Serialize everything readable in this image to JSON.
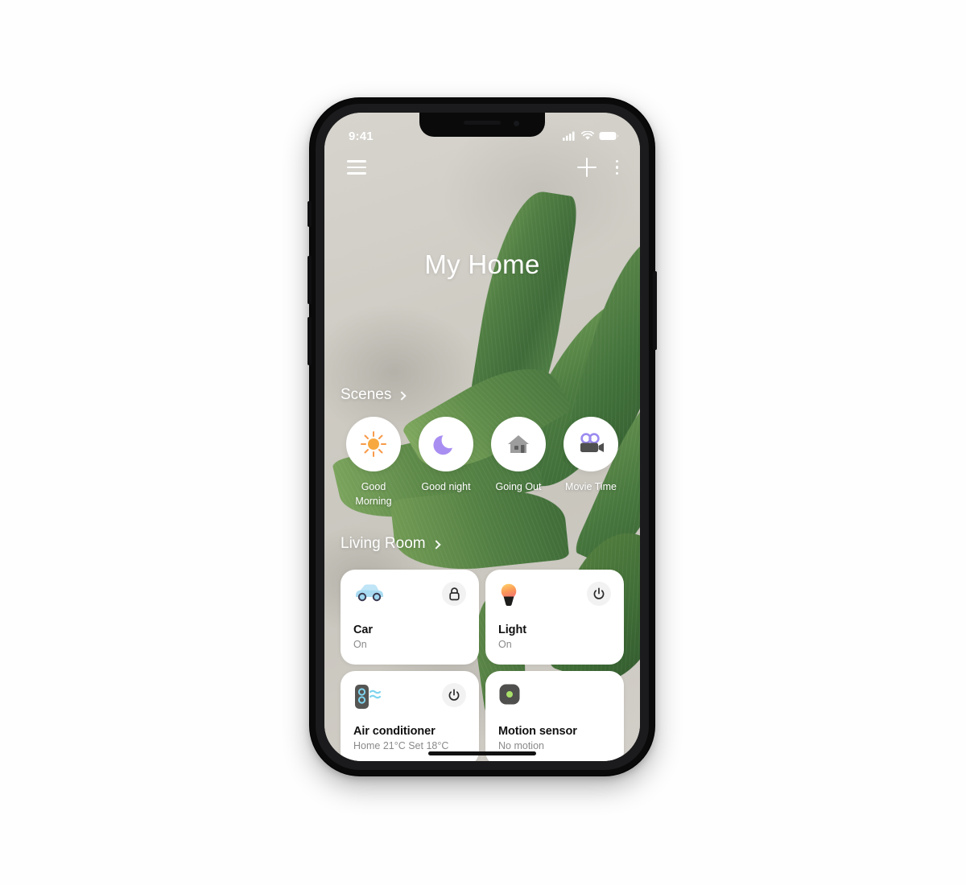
{
  "status_bar": {
    "time": "9:41",
    "icons": [
      "signal-icon",
      "wifi-icon",
      "battery-icon"
    ]
  },
  "top_bar": {
    "menu_icon": "hamburger-menu-icon",
    "add_icon": "plus-icon",
    "overflow_icon": "kebab-menu-icon"
  },
  "header": {
    "title": "My Home"
  },
  "scenes": {
    "section_label": "Scenes",
    "chevron": "chevron-right-icon",
    "items": [
      {
        "label": "Good Morning",
        "icon": "sun-icon",
        "color": "#f7a43a"
      },
      {
        "label": "Good night",
        "icon": "moon-icon",
        "color": "#a38df0"
      },
      {
        "label": "Going Out",
        "icon": "house-icon",
        "color": "#9b9b9b"
      },
      {
        "label": "Movie Time",
        "icon": "movie-camera-icon",
        "color": "#5a5a5a"
      }
    ]
  },
  "room": {
    "section_label": "Living Room",
    "chevron": "chevron-right-icon",
    "devices": [
      {
        "name": "Car",
        "status": "On",
        "icon": "car-icon",
        "action_icon": "lock-icon"
      },
      {
        "name": "Light",
        "status": "On",
        "icon": "lightbulb-icon",
        "action_icon": "power-icon"
      },
      {
        "name": "Air conditioner",
        "status": "Home 21°C  Set 18°C",
        "icon": "air-conditioner-icon",
        "action_icon": "power-icon"
      },
      {
        "name": "Motion sensor",
        "status": "No motion",
        "icon": "motion-sensor-icon",
        "action_icon": ""
      }
    ]
  },
  "theme": {
    "card_background": "#ffffff",
    "title_color": "#111111",
    "subtitle_color": "#8a8a8a",
    "wallpaper_base": "#cfcdc6",
    "leaf_green": "#5e8a49"
  }
}
